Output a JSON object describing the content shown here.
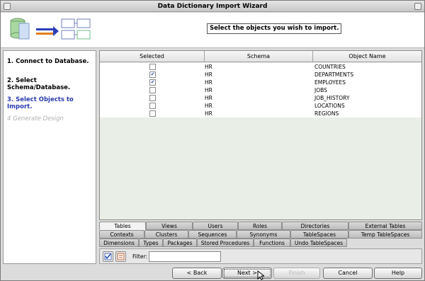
{
  "window": {
    "title": "Data Dictionary Import Wizard"
  },
  "header": {
    "instruction": "Select the objects you wish to import."
  },
  "steps": [
    {
      "label": "1. Connect to Database.",
      "state": "done"
    },
    {
      "label": "2. Select Schema/Database.",
      "state": "done"
    },
    {
      "label": "3. Select Objects to Import.",
      "state": "active"
    },
    {
      "label": "4  Generate Design",
      "state": "disabled"
    }
  ],
  "table": {
    "columns": [
      "Selected",
      "Schema",
      "Object Name"
    ],
    "rows": [
      {
        "selected": false,
        "schema": "HR",
        "name": "COUNTRIES"
      },
      {
        "selected": true,
        "schema": "HR",
        "name": "DEPARTMENTS"
      },
      {
        "selected": true,
        "schema": "HR",
        "name": "EMPLOYEES"
      },
      {
        "selected": false,
        "schema": "HR",
        "name": "JOBS"
      },
      {
        "selected": false,
        "schema": "HR",
        "name": "JOB_HISTORY"
      },
      {
        "selected": false,
        "schema": "HR",
        "name": "LOCATIONS"
      },
      {
        "selected": false,
        "schema": "HR",
        "name": "REGIONS"
      }
    ]
  },
  "tabs": {
    "row1": [
      "Tables",
      "Views",
      "Users",
      "Roles",
      "Directories",
      "External Tables"
    ],
    "row2": [
      "Contexts",
      "Clusters",
      "Sequences",
      "Synonyms",
      "TableSpaces",
      "Temp TableSpaces"
    ],
    "row3": [
      "Dimensions",
      "Types",
      "Packages",
      "Stored Procedures",
      "Functions",
      "Undo TableSpaces"
    ],
    "selected": "Tables"
  },
  "filter": {
    "label": "Filter:",
    "value": ""
  },
  "buttons": {
    "back": "< Back",
    "next": "Next >",
    "finish": "Finish",
    "cancel": "Cancel",
    "help": "Help"
  },
  "colors": {
    "active_step": "#2a3cb0",
    "check": "#1f4fb3",
    "grid_bg": "#e9eee6"
  },
  "icons": {
    "header": "database-to-table-import-icon",
    "filter_btn1": "select-all-icon",
    "filter_btn2": "select-none-icon"
  }
}
